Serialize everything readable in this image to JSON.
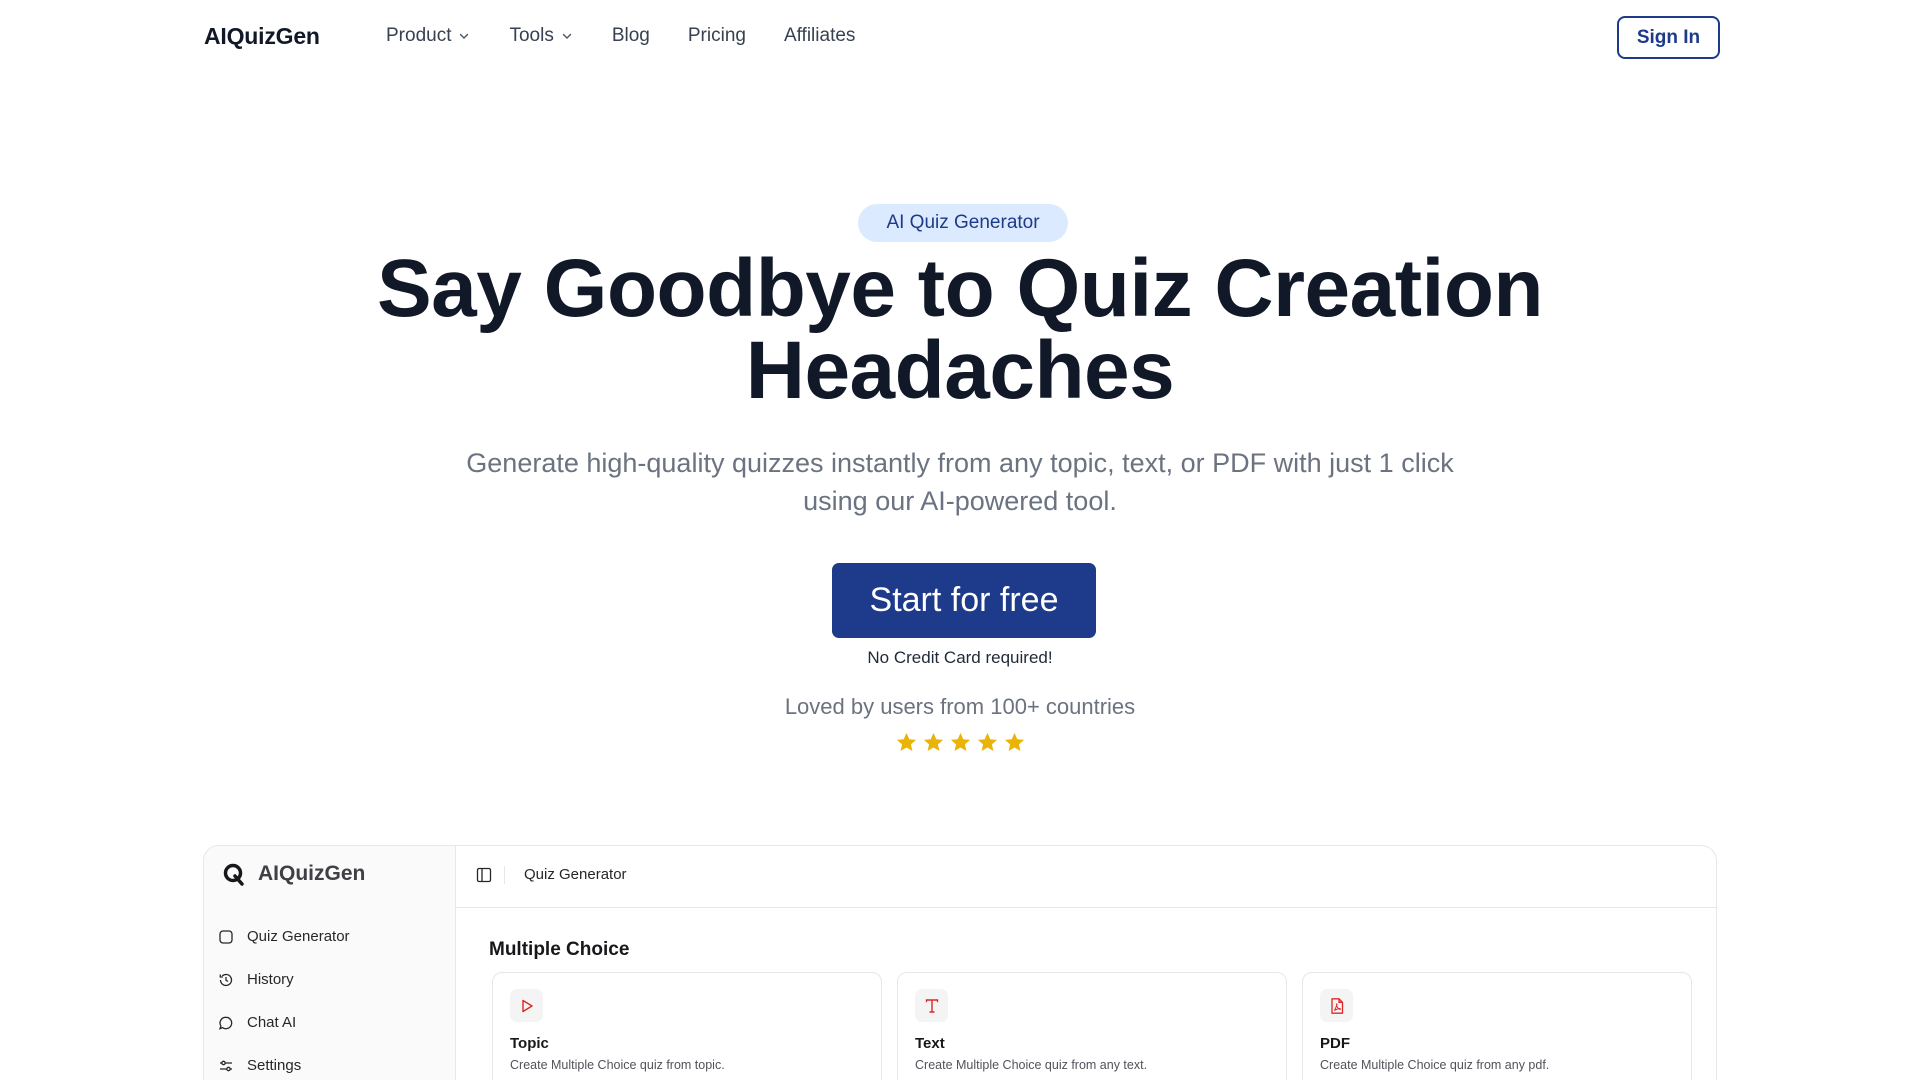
{
  "nav": {
    "logo": "AIQuizGen",
    "items": [
      {
        "label": "Product",
        "has_dropdown": true,
        "icon": "chevron-down-icon"
      },
      {
        "label": "Tools",
        "has_dropdown": true,
        "icon": "chevron-down-icon"
      },
      {
        "label": "Blog",
        "has_dropdown": false
      },
      {
        "label": "Pricing",
        "has_dropdown": false
      },
      {
        "label": "Affiliates",
        "has_dropdown": false
      }
    ],
    "signin_label": "Sign In"
  },
  "hero": {
    "badge": "AI Quiz Generator",
    "headline": "Say Goodbye to Quiz Creation Headaches",
    "subheadline": "Generate high-quality quizzes instantly from any topic, text, or PDF with just 1 click using our AI-powered tool.",
    "cta_label": "Start for free",
    "cta_note": "No Credit Card required!",
    "social_proof": "Loved by users from 100+ countries",
    "rating_stars": 5
  },
  "preview": {
    "logo": "AIQuizGen",
    "sidebar": [
      {
        "label": "Quiz Generator",
        "icon": "square-icon"
      },
      {
        "label": "History",
        "icon": "history-icon"
      },
      {
        "label": "Chat AI",
        "icon": "chat-bubble-icon"
      },
      {
        "label": "Settings",
        "icon": "sliders-icon"
      }
    ],
    "breadcrumb": "Quiz Generator",
    "section_title": "Multiple Choice",
    "cards": [
      {
        "title": "Topic",
        "desc": "Create Multiple Choice quiz from topic.",
        "icon": "play-icon"
      },
      {
        "title": "Text",
        "desc": "Create Multiple Choice quiz from any text.",
        "icon": "text-t-icon"
      },
      {
        "title": "PDF",
        "desc": "Create Multiple Choice quiz from any pdf.",
        "icon": "pdf-icon"
      }
    ]
  },
  "colors": {
    "brand": "#1e3a8a",
    "badge_bg": "#dbeafe",
    "star": "#eab308",
    "card_icon": "#dc2626"
  }
}
